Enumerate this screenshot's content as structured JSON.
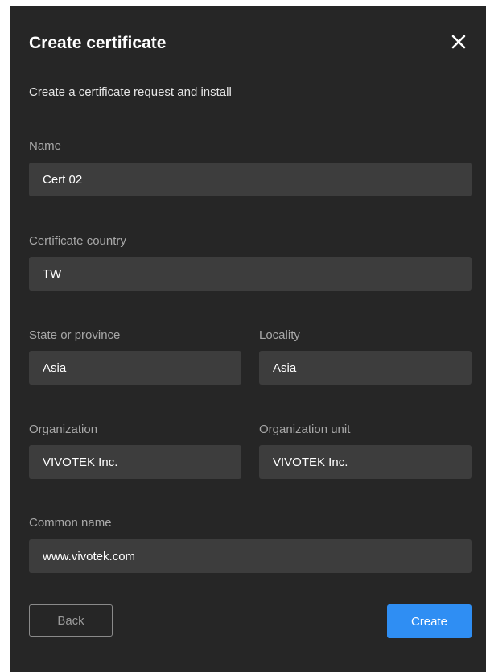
{
  "dialog": {
    "title": "Create certificate",
    "subtitle": "Create a certificate request and install"
  },
  "fields": {
    "name": {
      "label": "Name",
      "value": "Cert 02"
    },
    "country": {
      "label": "Certificate country",
      "value": "TW"
    },
    "state": {
      "label": "State or province",
      "value": "Asia"
    },
    "locality": {
      "label": "Locality",
      "value": "Asia"
    },
    "organization": {
      "label": "Organization",
      "value": "VIVOTEK Inc."
    },
    "organization_unit": {
      "label": "Organization unit",
      "value": "VIVOTEK Inc."
    },
    "common_name": {
      "label": "Common name",
      "value": "www.vivotek.com"
    }
  },
  "buttons": {
    "back": "Back",
    "create": "Create"
  },
  "colors": {
    "dialog_background": "#262626",
    "input_background": "#3d3d3d",
    "accent": "#2f8ef3"
  },
  "icons": {
    "close": "close-icon"
  }
}
